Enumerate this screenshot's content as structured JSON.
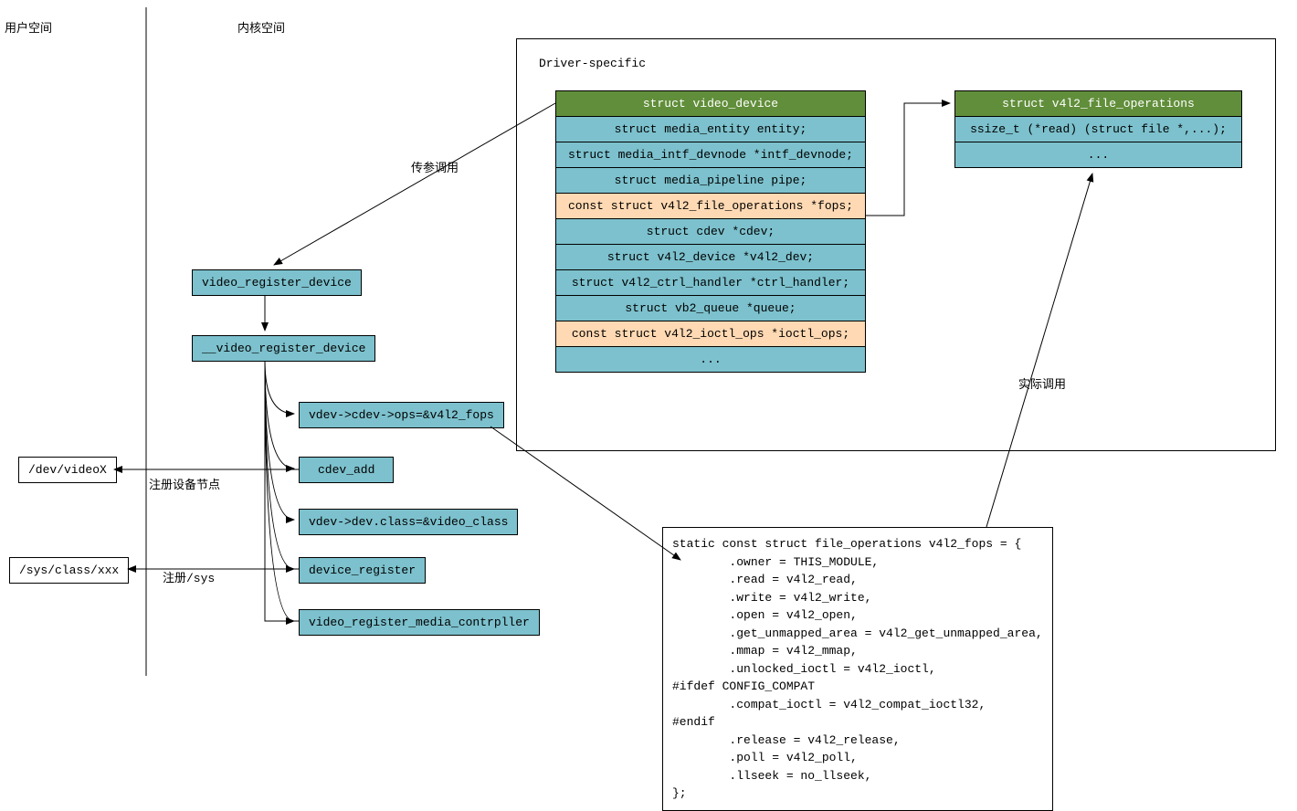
{
  "labels": {
    "user_space": "用户空间",
    "kernel_space": "内核空间",
    "driver_specific": "Driver-specific",
    "pass_param": "传参调用",
    "actual_call": "实际调用",
    "register_node": "注册设备节点",
    "register_sys": "注册/sys"
  },
  "userspace": {
    "dev_video": "/dev/videoX",
    "sys_class": "/sys/class/xxx"
  },
  "flow": {
    "video_register_device": "video_register_device",
    "__video_register_device": "__video_register_device",
    "ops_assign": "vdev->cdev->ops=&v4l2_fops",
    "cdev_add": "cdev_add",
    "class_assign": "vdev->dev.class=&video_class",
    "device_register": "device_register",
    "media_controller": "video_register_media_contrpller"
  },
  "video_device": {
    "header": "struct video_device",
    "rows": [
      "struct media_entity entity;",
      "struct media_intf_devnode *intf_devnode;",
      "struct media_pipeline pipe;",
      "const struct v4l2_file_operations *fops;",
      "struct cdev *cdev;",
      "struct v4l2_device *v4l2_dev;",
      "struct v4l2_ctrl_handler *ctrl_handler;",
      "struct vb2_queue *queue;",
      "const struct v4l2_ioctl_ops *ioctl_ops;",
      "..."
    ]
  },
  "file_ops": {
    "header": "struct v4l2_file_operations",
    "rows": [
      "ssize_t (*read) (struct file *,...);",
      "..."
    ]
  },
  "code": "static const struct file_operations v4l2_fops = {\n        .owner = THIS_MODULE,\n        .read = v4l2_read,\n        .write = v4l2_write,\n        .open = v4l2_open,\n        .get_unmapped_area = v4l2_get_unmapped_area,\n        .mmap = v4l2_mmap,\n        .unlocked_ioctl = v4l2_ioctl,\n#ifdef CONFIG_COMPAT\n        .compat_ioctl = v4l2_compat_ioctl32,\n#endif\n        .release = v4l2_release,\n        .poll = v4l2_poll,\n        .llseek = no_llseek,\n};"
}
